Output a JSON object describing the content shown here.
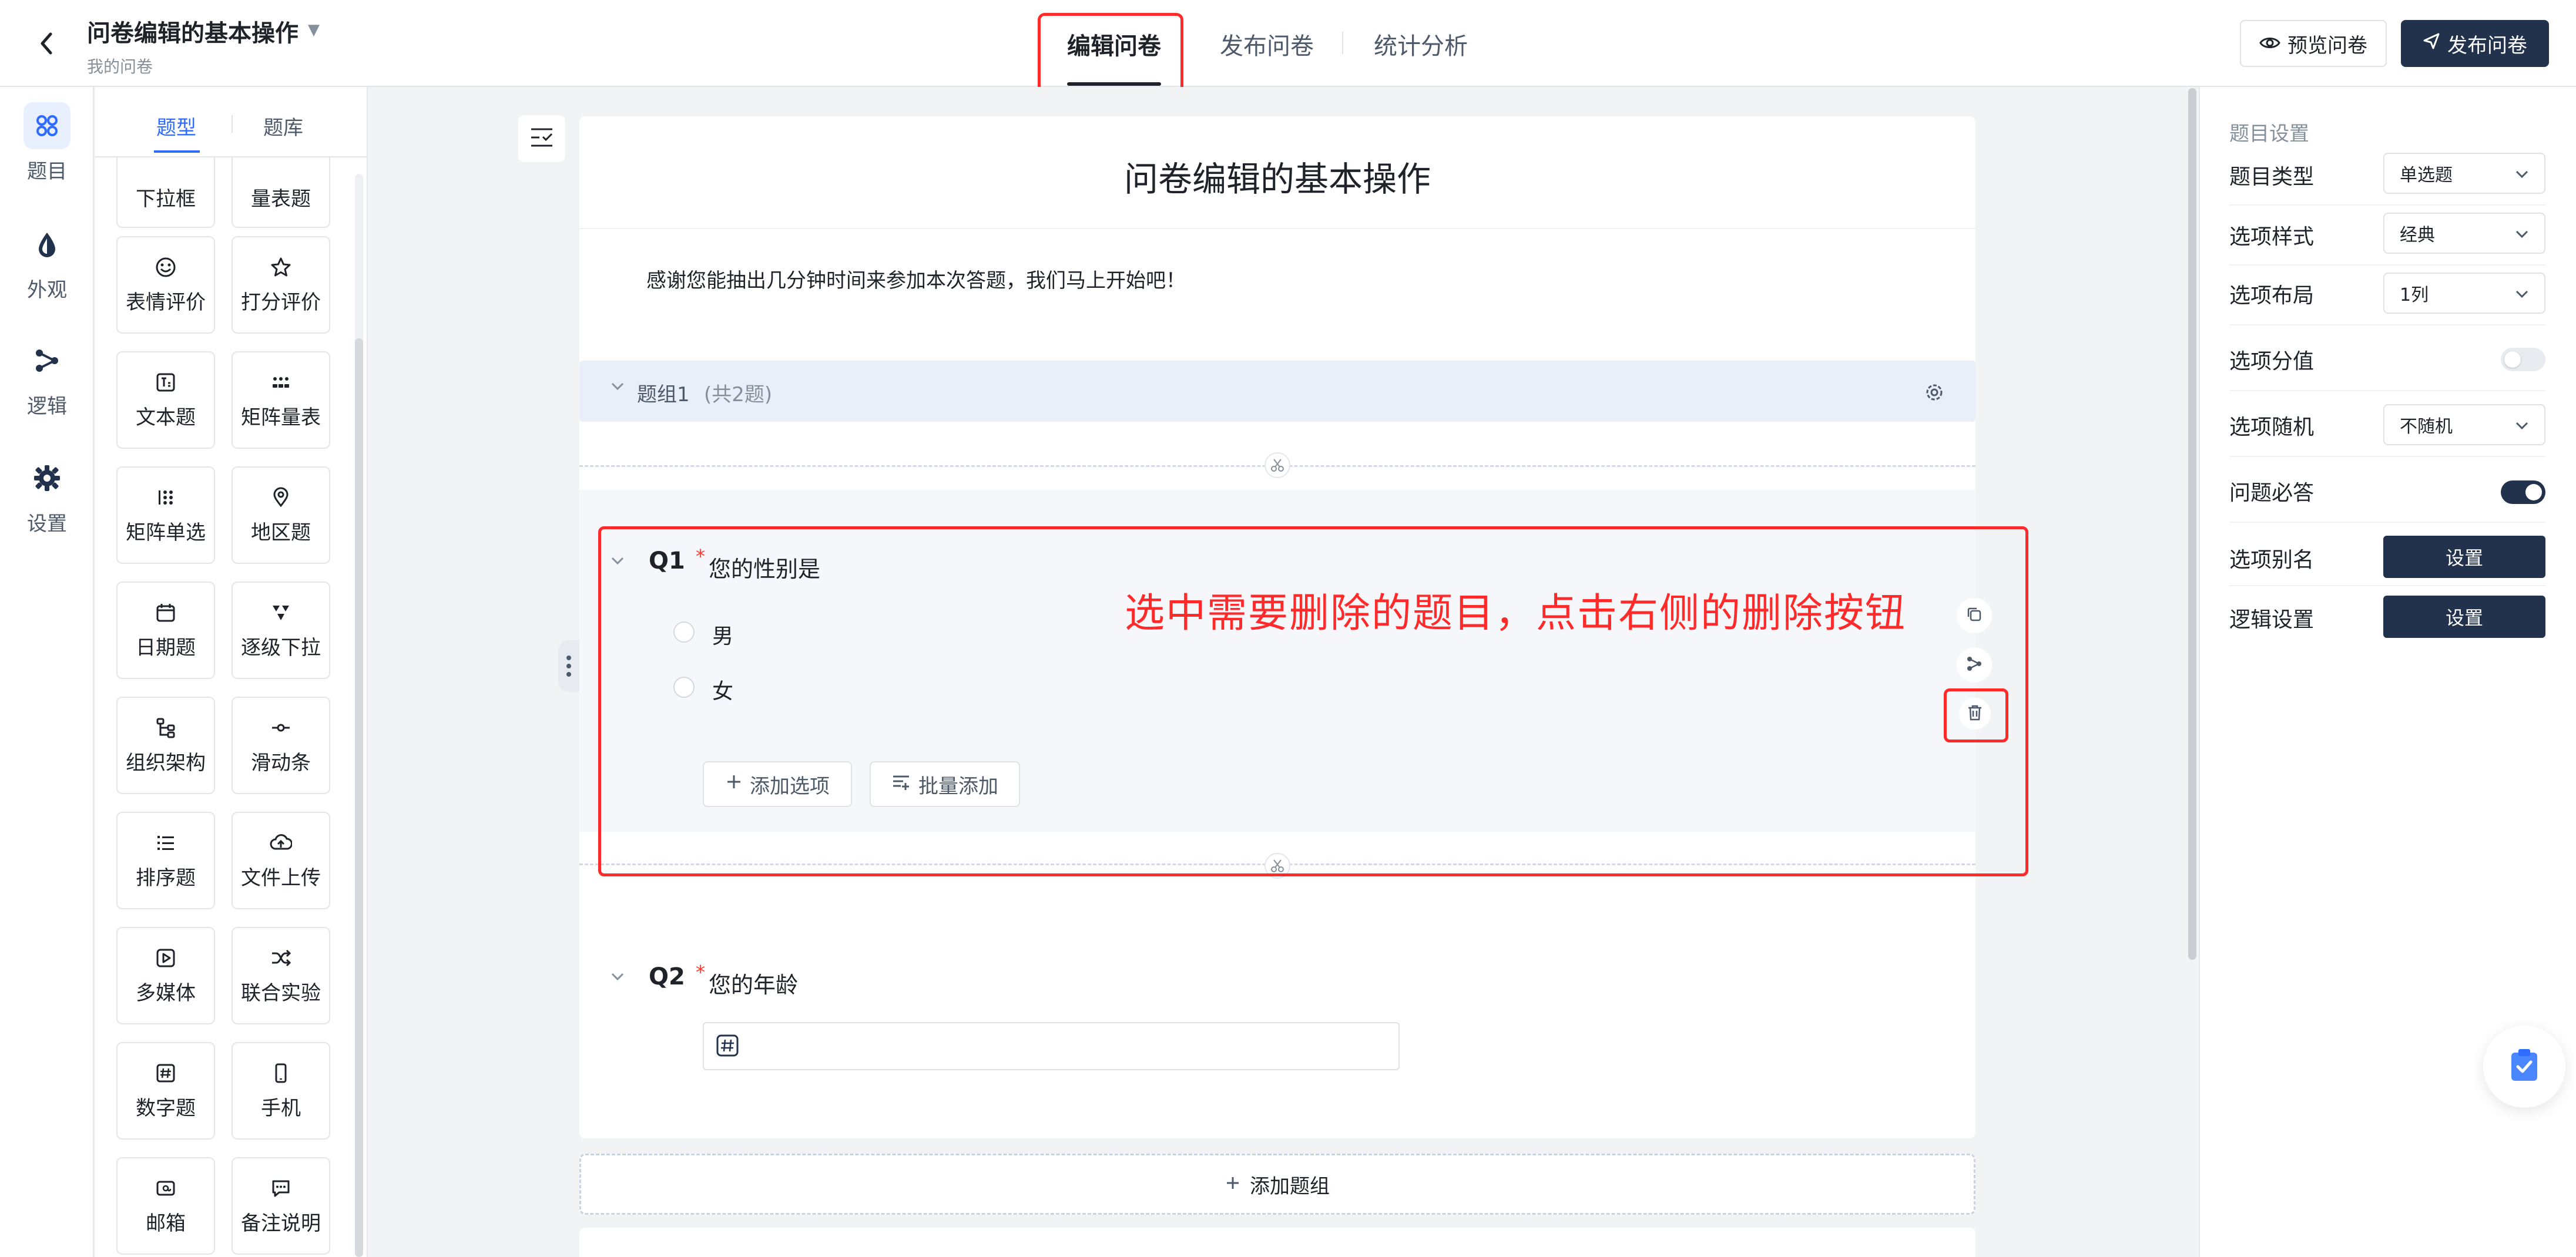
{
  "header": {
    "back_label": "‹",
    "title": "问卷编辑的基本操作",
    "subtitle": "我的问卷",
    "tabs": [
      "编辑问卷",
      "发布问卷",
      "统计分析"
    ],
    "preview_label": "预览问卷",
    "publish_label": "发布问卷"
  },
  "rail": [
    "题目",
    "外观",
    "逻辑",
    "设置"
  ],
  "palette": {
    "tabs": [
      "题型",
      "题库"
    ],
    "items": [
      [
        "下拉框",
        "量表题"
      ],
      [
        "表情评价",
        "打分评价"
      ],
      [
        "文本题",
        "矩阵量表"
      ],
      [
        "矩阵单选",
        "地区题"
      ],
      [
        "日期题",
        "逐级下拉"
      ],
      [
        "组织架构",
        "滑动条"
      ],
      [
        "排序题",
        "文件上传"
      ],
      [
        "多媒体",
        "联合实验"
      ],
      [
        "数字题",
        "手机"
      ],
      [
        "邮箱",
        "备注说明"
      ]
    ]
  },
  "survey": {
    "title": "问卷编辑的基本操作",
    "intro": "感谢您能抽出几分钟时间来参加本次答题，我们马上开始吧！",
    "group_name": "题组1",
    "group_count": "(共2题)",
    "q1": {
      "number": "Q1",
      "required": "*",
      "title": "您的性别是",
      "options": [
        "男",
        "女"
      ],
      "add_option": "添加选项",
      "bulk_add": "批量添加"
    },
    "annotation": "选中需要删除的题目，点击右侧的删除按钮",
    "q2": {
      "number": "Q2",
      "required": "*",
      "title": "您的年龄"
    },
    "add_group": "添加题组"
  },
  "settings": {
    "heading": "题目设置",
    "rows": {
      "type_label": "题目类型",
      "type_value": "单选题",
      "style_label": "选项样式",
      "style_value": "经典",
      "layout_label": "选项布局",
      "layout_value": "1列",
      "score_label": "选项分值",
      "score_on": false,
      "random_label": "选项随机",
      "random_value": "不随机",
      "required_label": "问题必答",
      "required_on": true,
      "alias_label": "选项别名",
      "alias_btn": "设置",
      "logic_label": "逻辑设置",
      "logic_btn": "设置"
    }
  },
  "colors": {
    "accent": "#2f6bff",
    "primary_dark": "#22324c",
    "annotation_red": "#ff2a2a",
    "group_band": "#e8eff9"
  }
}
